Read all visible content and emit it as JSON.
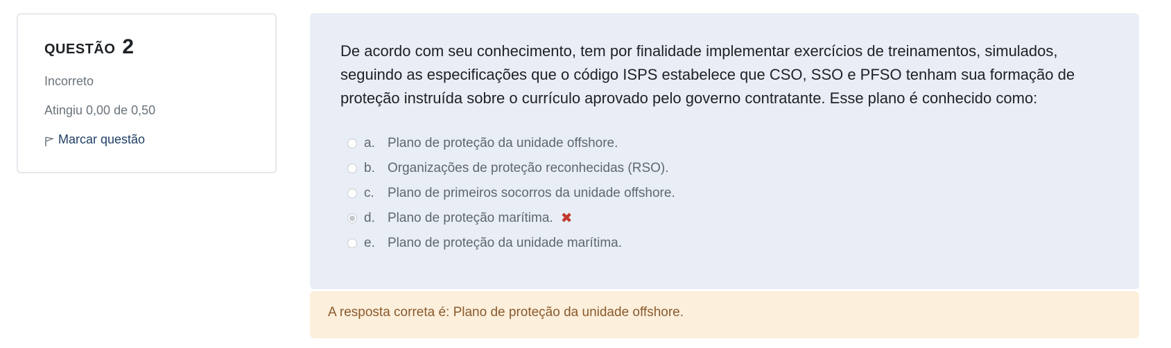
{
  "info": {
    "question_word": "QUESTÃO",
    "question_number": "2",
    "state": "Incorreto",
    "grade": "Atingiu 0,00 de 0,50",
    "flag_label": "Marcar questão"
  },
  "question": {
    "text": "De acordo com seu conhecimento, tem por finalidade implementar exercícios de treinamentos, simulados, seguindo as especificações que o código ISPS estabelece que CSO, SSO e PFSO tenham sua formação de proteção instruída sobre o currículo aprovado pelo governo contratante. Esse plano é conhecido como:",
    "options": [
      {
        "letter": "a.",
        "text": "Plano de proteção da unidade offshore.",
        "selected": false
      },
      {
        "letter": "b.",
        "text": "Organizações de proteção reconhecidas (RSO).",
        "selected": false
      },
      {
        "letter": "c.",
        "text": "Plano de primeiros socorros da unidade offshore.",
        "selected": false
      },
      {
        "letter": "d.",
        "text": "Plano de proteção marítima.",
        "selected": true,
        "feedback_icon": "wrong-x-icon",
        "feedback_color": "#c0392b"
      },
      {
        "letter": "e.",
        "text": "Plano de proteção da unidade marítima.",
        "selected": false
      }
    ]
  },
  "feedback": {
    "correct_answer": "A resposta correta é: Plano de proteção da unidade offshore."
  },
  "colors": {
    "question_bg": "#e9edf5",
    "feedback_bg": "#fcefdc",
    "link": "#1f3f66"
  }
}
